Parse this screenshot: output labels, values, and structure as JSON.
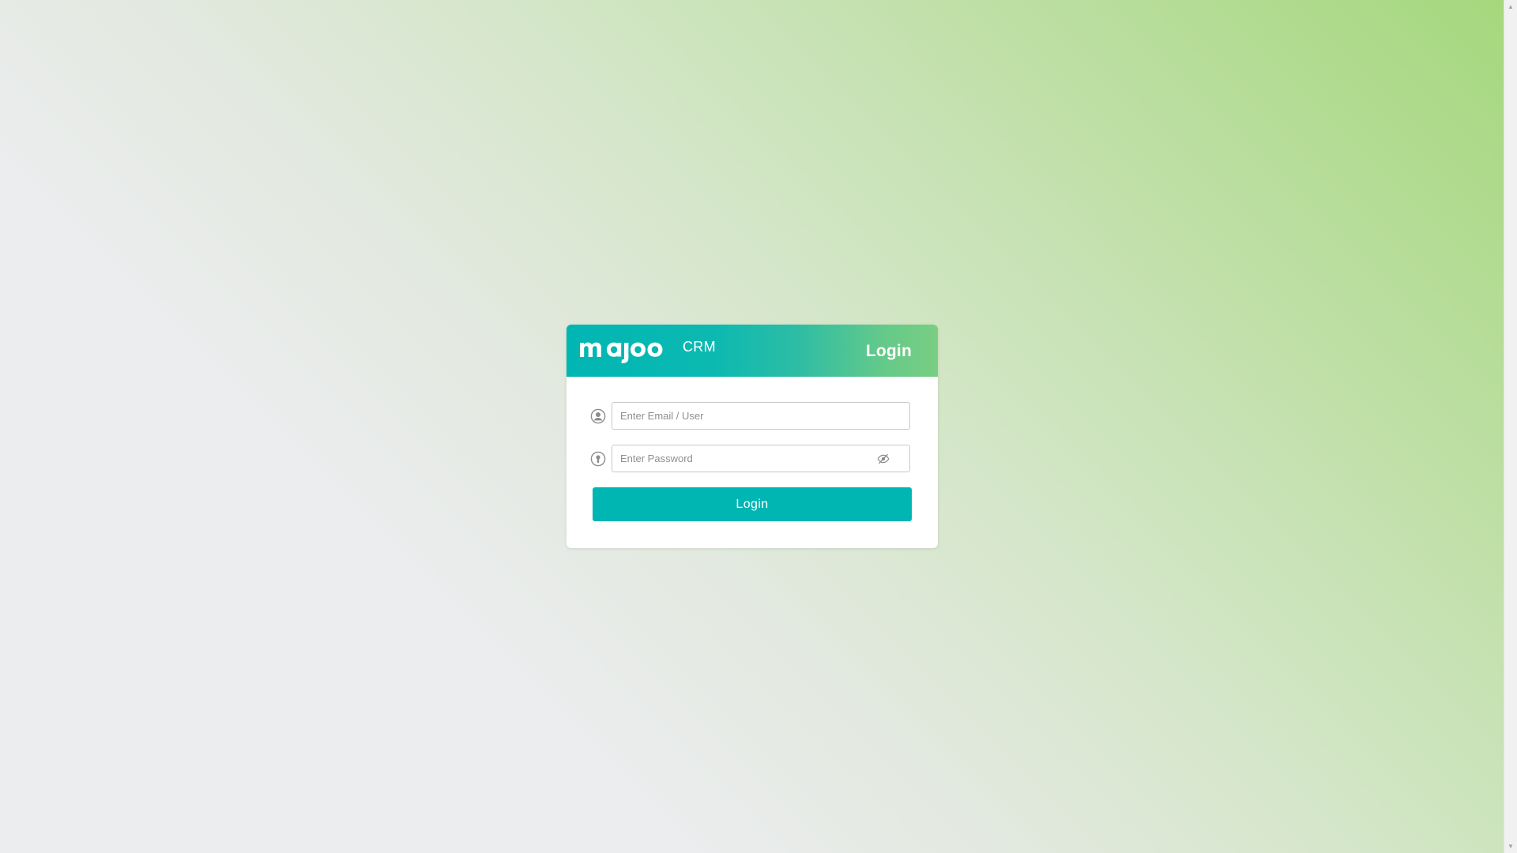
{
  "brand": {
    "logo_text": "majoo",
    "product_label": "CRM"
  },
  "header": {
    "title": "Login"
  },
  "form": {
    "email": {
      "placeholder": "Enter Email / User",
      "value": "",
      "icon": "user-circle-icon"
    },
    "password": {
      "placeholder": "Enter Password",
      "value": "",
      "icon": "lock-circle-icon",
      "toggle_icon": "eye-off-icon"
    },
    "submit_label": "Login"
  },
  "colors": {
    "accent": "#00b6b3",
    "header_gradient_end": "#79ce82",
    "background_green": "#a5d77c",
    "background_gray": "#ecedef"
  }
}
